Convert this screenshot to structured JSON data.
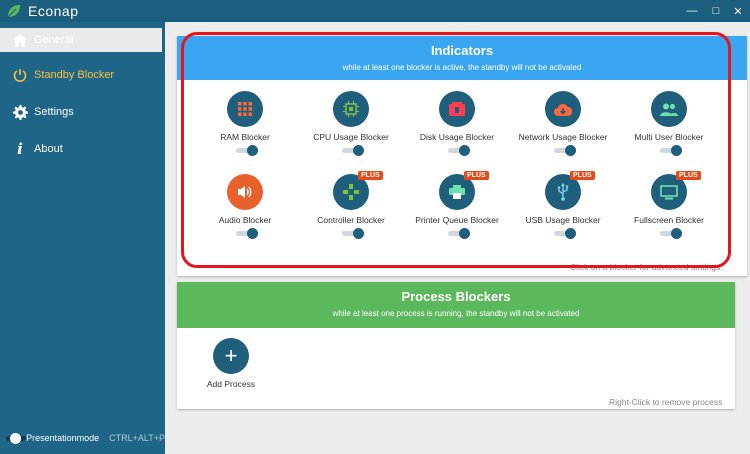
{
  "app": {
    "title": "Econap",
    "colors": {
      "titlebar": "#1c5e7e",
      "sidebar": "#1e6587",
      "accent": "#f6c342",
      "blue_header": "#3aa5f0",
      "green_header": "#5cb85c",
      "highlight": "#e6141e",
      "plus_badge": "#e64a19"
    }
  },
  "window_controls": {
    "minimize": "—",
    "maximize": "□",
    "close": "✕"
  },
  "sidebar": {
    "items": [
      {
        "label": "General",
        "icon": "home-icon"
      },
      {
        "label": "Standby Blocker",
        "icon": "power-icon"
      },
      {
        "label": "Settings",
        "icon": "gear-icon"
      },
      {
        "label": "About",
        "icon": "info-icon"
      }
    ],
    "presentation_mode": {
      "label": "Presentationmode",
      "shortcut": "CTRL+ALT+P",
      "enabled": false
    }
  },
  "indicators": {
    "title": "Indicators",
    "subtitle": "while at least one blocker is active, the standby will not be activated",
    "hint": "Click on a blocker for advanced settings.",
    "blockers": [
      {
        "label": "RAM Blocker",
        "icon": "ram-grid-icon",
        "enabled": true,
        "plus": false
      },
      {
        "label": "CPU Usage Blocker",
        "icon": "cpu-chip-icon",
        "enabled": true,
        "plus": false
      },
      {
        "label": "Disk Usage Blocker",
        "icon": "disk-icon",
        "enabled": true,
        "plus": false
      },
      {
        "label": "Network Usage Blocker",
        "icon": "cloud-download-icon",
        "enabled": true,
        "plus": false
      },
      {
        "label": "Multi User Blocker",
        "icon": "users-icon",
        "enabled": true,
        "plus": false
      },
      {
        "label": "Audio Blocker",
        "icon": "speaker-icon",
        "enabled": true,
        "plus": false
      },
      {
        "label": "Controller Blocker",
        "icon": "gamepad-icon",
        "enabled": true,
        "plus": true
      },
      {
        "label": "Printer Queue Blocker",
        "icon": "printer-icon",
        "enabled": true,
        "plus": true
      },
      {
        "label": "USB Usage Blocker",
        "icon": "usb-icon",
        "enabled": true,
        "plus": true
      },
      {
        "label": "Fullscreen Blocker",
        "icon": "monitor-icon",
        "enabled": true,
        "plus": true
      }
    ],
    "plus_badge": "PLUS"
  },
  "process_blockers": {
    "title": "Process Blockers",
    "subtitle": "while at least one process is running, the standby will not be activated",
    "add_label": "Add Process",
    "hint": "Right-Click to remove process"
  }
}
